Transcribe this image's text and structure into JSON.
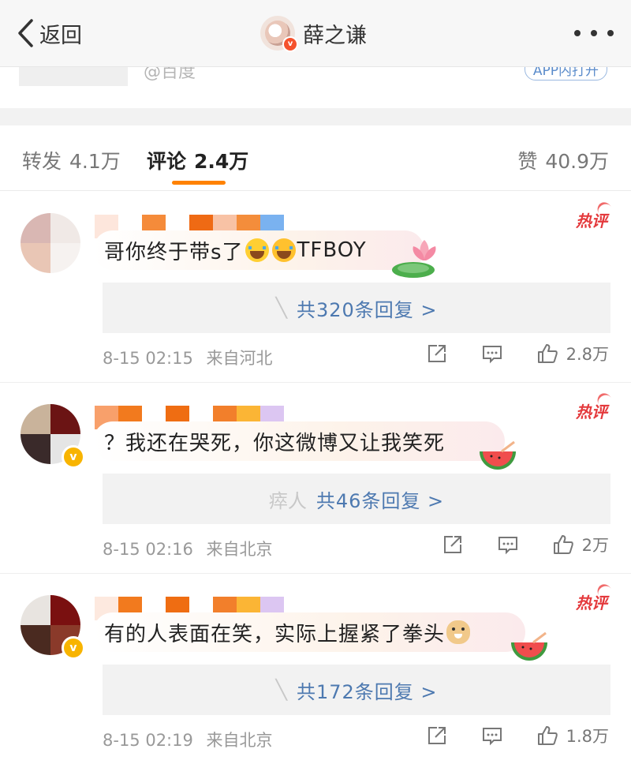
{
  "nav": {
    "back_label": "返回",
    "title": "薛之谦",
    "icons": [
      "chevron-left-icon",
      "avatar",
      "more-dots-icon"
    ]
  },
  "card": {
    "source": "@百度",
    "app_open": "APP内打开"
  },
  "tabs": [
    {
      "label": "转发",
      "count": "4.1万",
      "active": false
    },
    {
      "label": "评论",
      "count": "2.4万",
      "active": true
    },
    {
      "label": "赞",
      "count": "40.9万",
      "active": false
    }
  ],
  "colors": {
    "accent": "#ff8200",
    "link": "#4d79b0",
    "hot": "#e4393c",
    "verified": "#f8b400"
  },
  "comments": [
    {
      "hot_label": "热评",
      "text": "哥你终于带s了",
      "text_suffix": "TFBOY",
      "emojis": [
        "crying-emoji",
        "crying-emoji"
      ],
      "decoration": "lotus",
      "reply_prefix": "╲",
      "reply_label": "共320条回复 >",
      "time": "8-15 02:15",
      "location": "来自河北",
      "likes": "2.8万"
    },
    {
      "hot_label": "热评",
      "text": "？我还在哭死，你这微博又让我笑死",
      "decoration": "watermelon",
      "reply_prefix": "瘁人",
      "reply_label": "共46条回复 >",
      "time": "8-15 02:16",
      "location": "来自北京",
      "likes": "2万"
    },
    {
      "hot_label": "热评",
      "text": "有的人表面在笑，实际上握紧了拳头",
      "emojis": [
        "doge-emoji"
      ],
      "decoration": "watermelon",
      "reply_prefix": "╲",
      "reply_label": "共172条回复 >",
      "time": "8-15 02:19",
      "location": "来自北京",
      "likes": "1.8万"
    }
  ]
}
